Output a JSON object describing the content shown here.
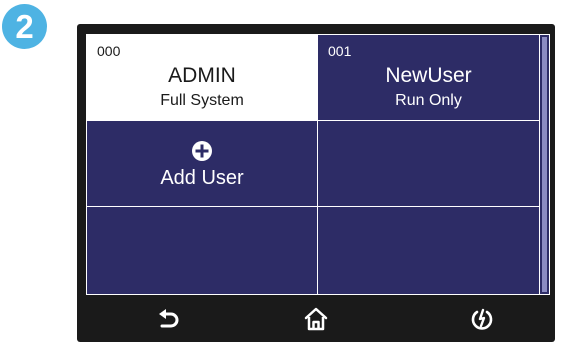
{
  "step_badge": "2",
  "users": [
    {
      "number": "000",
      "name": "ADMIN",
      "role": "Full System",
      "selected": true
    },
    {
      "number": "001",
      "name": "NewUser",
      "role": "Run Only",
      "selected": false
    }
  ],
  "add_user": {
    "label": "Add User",
    "icon": "plus-circle-icon"
  },
  "navbar": {
    "back_icon": "back-arrow-icon",
    "home_icon": "home-icon",
    "power_icon": "power-icon"
  },
  "colors": {
    "screen_background": "#2d2c66",
    "selected_cell": "#ffffff",
    "badge": "#4eb3e3",
    "bezel": "#1a1a1a"
  }
}
